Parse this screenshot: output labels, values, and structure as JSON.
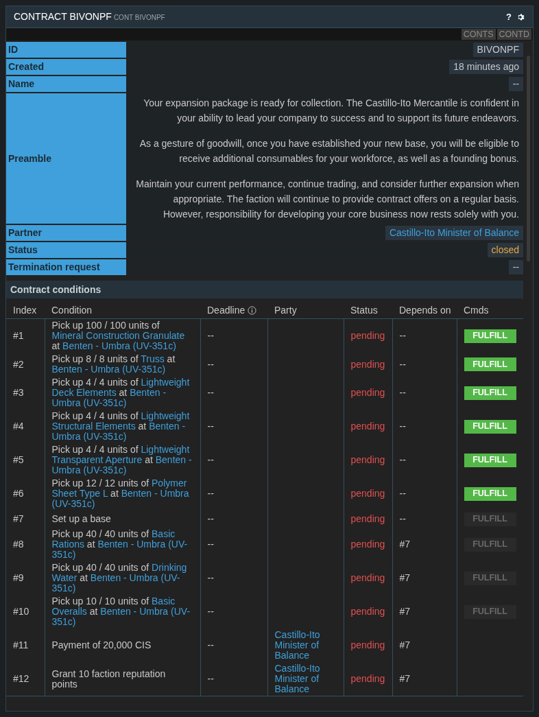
{
  "window": {
    "title": "CONTRACT BIVONPF",
    "subtitle": "CONT BIVONPF",
    "help": "?"
  },
  "toolbar": [
    "CONTS",
    "CONTD"
  ],
  "fields": [
    {
      "label": "ID",
      "value": "BIVONPF",
      "kind": "plain"
    },
    {
      "label": "Created",
      "value": "18 minutes ago",
      "kind": "plain"
    },
    {
      "label": "Name",
      "value": "--",
      "kind": "plain"
    },
    {
      "label": "Preamble",
      "kind": "text",
      "paragraphs": [
        "Your expansion package is ready for collection. The Castillo-Ito Mercantile is confident in your ability to lead your company to success and to support its future endeavors.",
        "As a gesture of goodwill, once you have established your new base, you will be eligible to receive additional consumables for your workforce, as well as a founding bonus.",
        "Maintain your current performance, continue trading, and consider further expansion when appropriate. The faction will continue to provide contract offers on a regular basis. However, responsibility for developing your core business now rests solely with you."
      ]
    },
    {
      "label": "Partner",
      "value": "Castillo-Ito Minister of Balance",
      "kind": "link"
    },
    {
      "label": "Status",
      "value": "closed",
      "kind": "status"
    },
    {
      "label": "Termination request",
      "value": "--",
      "kind": "plain"
    }
  ],
  "conditions": {
    "title": "Contract conditions",
    "columns": [
      "Index",
      "Condition",
      "Deadline",
      "Party",
      "Status",
      "Depends on",
      "Cmds"
    ],
    "rows": [
      {
        "index": "#1",
        "condition": [
          {
            "text": "Pick up 100 / 100 units of ",
            "link": false
          },
          {
            "text": "Mineral Construction Granulate",
            "link": true
          },
          {
            "text": " at ",
            "link": false
          },
          {
            "text": "Benten - Umbra (UV-351c)",
            "link": true
          }
        ],
        "deadline": "--",
        "status": "pending",
        "depends": "--",
        "command": {
          "label": "FULFILL",
          "disabled": false
        }
      },
      {
        "index": "#2",
        "condition": [
          {
            "text": "Pick up 8 / 8 units of ",
            "link": false
          },
          {
            "text": "Truss",
            "link": true
          },
          {
            "text": " at ",
            "link": false
          },
          {
            "text": "Benten - Umbra (UV-351c)",
            "link": true
          }
        ],
        "deadline": "--",
        "status": "pending",
        "depends": "--",
        "command": {
          "label": "FULFILL",
          "disabled": false
        }
      },
      {
        "index": "#3",
        "condition": [
          {
            "text": "Pick up 4 / 4 units of ",
            "link": false
          },
          {
            "text": "Lightweight Deck Elements",
            "link": true
          },
          {
            "text": " at ",
            "link": false
          },
          {
            "text": "Benten - Umbra (UV-351c)",
            "link": true
          }
        ],
        "deadline": "--",
        "status": "pending",
        "depends": "--",
        "command": {
          "label": "FULFILL",
          "disabled": false
        }
      },
      {
        "index": "#4",
        "condition": [
          {
            "text": "Pick up 4 / 4 units of ",
            "link": false
          },
          {
            "text": "Lightweight Structural Elements",
            "link": true
          },
          {
            "text": " at ",
            "link": false
          },
          {
            "text": "Benten - Umbra (UV-351c)",
            "link": true
          }
        ],
        "deadline": "--",
        "status": "pending",
        "depends": "--",
        "command": {
          "label": "FULFILL",
          "disabled": false
        }
      },
      {
        "index": "#5",
        "condition": [
          {
            "text": "Pick up 4 / 4 units of ",
            "link": false
          },
          {
            "text": "Lightweight Transparent Aperture",
            "link": true
          },
          {
            "text": " at ",
            "link": false
          },
          {
            "text": "Benten - Umbra (UV-351c)",
            "link": true
          }
        ],
        "deadline": "--",
        "status": "pending",
        "depends": "--",
        "command": {
          "label": "FULFILL",
          "disabled": false
        }
      },
      {
        "index": "#6",
        "condition": [
          {
            "text": "Pick up 12 / 12 units of ",
            "link": false
          },
          {
            "text": "Polymer Sheet Type L",
            "link": true
          },
          {
            "text": " at ",
            "link": false
          },
          {
            "text": "Benten - Umbra (UV-351c)",
            "link": true
          }
        ],
        "deadline": "--",
        "status": "pending",
        "depends": "--",
        "command": {
          "label": "FULFILL",
          "disabled": false
        }
      },
      {
        "index": "#7",
        "condition": [
          {
            "text": "Set up a base",
            "link": false
          }
        ],
        "deadline": "--",
        "status": "pending",
        "depends": "--",
        "command": {
          "label": "FULFILL",
          "disabled": true
        }
      },
      {
        "index": "#8",
        "condition": [
          {
            "text": "Pick up 40 / 40 units of ",
            "link": false
          },
          {
            "text": "Basic Rations",
            "link": true
          },
          {
            "text": " at ",
            "link": false
          },
          {
            "text": "Benten - Umbra (UV-351c)",
            "link": true
          }
        ],
        "deadline": "--",
        "status": "pending",
        "depends": "#7",
        "command": {
          "label": "FULFILL",
          "disabled": true
        }
      },
      {
        "index": "#9",
        "condition": [
          {
            "text": "Pick up 40 / 40 units of ",
            "link": false
          },
          {
            "text": "Drinking Water",
            "link": true
          },
          {
            "text": " at ",
            "link": false
          },
          {
            "text": "Benten - Umbra (UV-351c)",
            "link": true
          }
        ],
        "deadline": "--",
        "status": "pending",
        "depends": "#7",
        "command": {
          "label": "FULFILL",
          "disabled": true
        }
      },
      {
        "index": "#10",
        "condition": [
          {
            "text": "Pick up 10 / 10 units of ",
            "link": false
          },
          {
            "text": "Basic Overalls",
            "link": true
          },
          {
            "text": " at ",
            "link": false
          },
          {
            "text": "Benten - Umbra (UV-351c)",
            "link": true
          }
        ],
        "deadline": "--",
        "status": "pending",
        "depends": "#7",
        "command": {
          "label": "FULFILL",
          "disabled": true
        }
      },
      {
        "index": "#11",
        "condition": [
          {
            "text": "Payment of 20,000 CIS",
            "link": false
          }
        ],
        "deadline": "--",
        "party": "Castillo-Ito Minister of Balance",
        "status": "pending",
        "depends": "#7"
      },
      {
        "index": "#12",
        "condition": [
          {
            "text": "Grant 10 faction reputation points",
            "link": false
          }
        ],
        "deadline": "--",
        "party": "Castillo-Ito Minister of Balance",
        "status": "pending",
        "depends": "#7"
      }
    ]
  }
}
